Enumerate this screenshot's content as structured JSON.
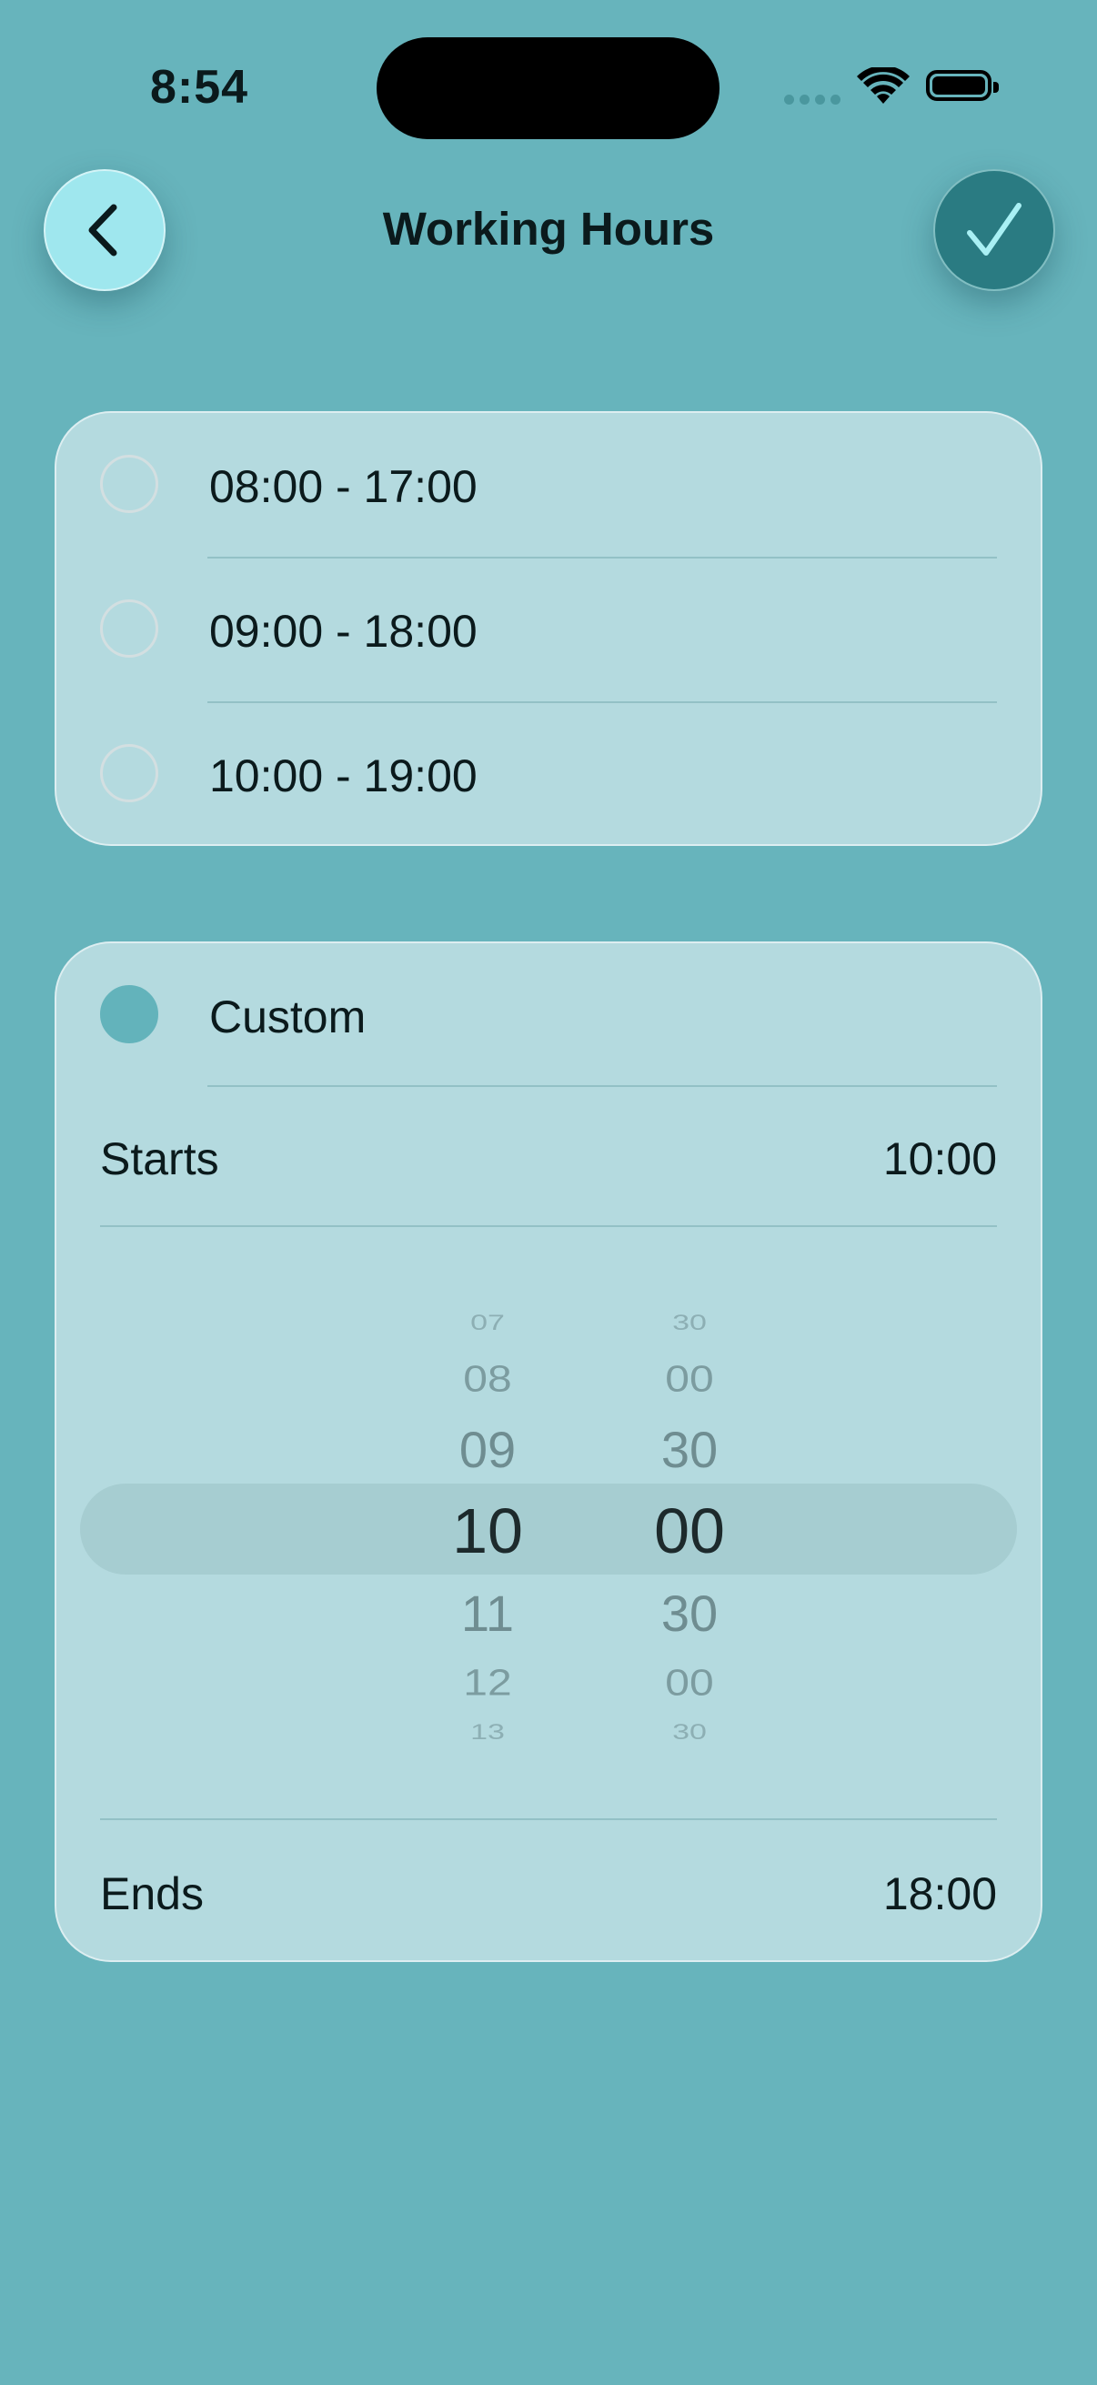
{
  "status_bar": {
    "time": "8:54"
  },
  "nav": {
    "title": "Working Hours",
    "back_icon": "chevron-left-icon",
    "confirm_icon": "checkmark-icon"
  },
  "presets": [
    {
      "label": "08:00 - 17:00",
      "selected": false
    },
    {
      "label": "09:00 - 18:00",
      "selected": false
    },
    {
      "label": "10:00 - 19:00",
      "selected": false
    }
  ],
  "custom": {
    "label": "Custom",
    "selected": true,
    "starts_label": "Starts",
    "starts_value": "10:00",
    "ends_label": "Ends",
    "ends_value": "18:00",
    "picker": {
      "hours": [
        "07",
        "08",
        "09",
        "10",
        "11",
        "12",
        "13"
      ],
      "minutes": [
        "30",
        "00",
        "30",
        "00",
        "30",
        "00",
        "30"
      ],
      "selected_hour": "10",
      "selected_minute": "00"
    }
  },
  "colors": {
    "background": "#67b4bc",
    "card": "#b4dadf",
    "accent": "#63b3bb",
    "confirm_button": "#2a7b82",
    "back_button": "#9fe7ee"
  }
}
